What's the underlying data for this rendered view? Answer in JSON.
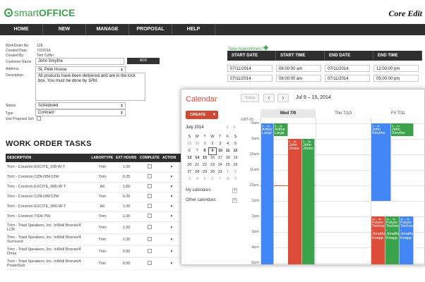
{
  "app": {
    "logo_smart": "smart",
    "logo_office": "OFFICE",
    "corner_title": "Core Edit"
  },
  "nav": [
    "HOME",
    "NEW",
    "MANAGE",
    "PROPOSAL",
    "HELP"
  ],
  "form": {
    "workorder_no_label": "WorkOrder No:",
    "workorder_no": "128",
    "created_date_label": "Created Date:",
    "created_date": "7/2/2014",
    "created_by_label": "Created By:",
    "created_by": "Tom Coffin",
    "customer_name_label": "Customer Name",
    "customer_name": "John Smythe",
    "add_label": "ADD",
    "address_label": "Address",
    "address": "St. Pete House",
    "description_label": "Description",
    "description": "All products have been delivered and are in the lock box. You must be done by 1PM.",
    "status_label": "Status",
    "status": "Scheduled",
    "type_label": "Type",
    "type": "Contract",
    "use_proposal_label": "Use Proposal Sch"
  },
  "tasks": {
    "title": "WORK ORDER TASKS",
    "headers": [
      "DESCRIPTION",
      "LABORTYPE",
      "EXT HOURS",
      "COMPLETE",
      "ACTION"
    ],
    "rows": [
      {
        "desc": "Trim - Crestron EXCITE_IO8-W-T",
        "labor": "Trim",
        "hours": "1.00"
      },
      {
        "desc": "Trim - Crestron C2N-DBF12W",
        "labor": "Trim",
        "hours": "0.25"
      },
      {
        "desc": "Trim - Crestron EXCITE_IW6-W-T",
        "labor": "All",
        "hours": "1.00"
      },
      {
        "desc": "Trim - Crestron C2N-DBF12W",
        "labor": "Trim",
        "hours": "0.25"
      },
      {
        "desc": "Trim - Crestron EXCITE_IW6-W-T",
        "labor": "All",
        "hours": "1.00"
      },
      {
        "desc": "Trim - Crestron TSW-750",
        "labor": "Trim",
        "hours": "1.00"
      },
      {
        "desc": "Trim - Triad Speakers, Inc. InWall Bronze/4 LCR",
        "labor": "Trim",
        "hours": "1.50"
      },
      {
        "desc": "Trim - Triad Speakers, Inc. InWall Bronze/4 Surround",
        "labor": "Trim",
        "hours": "1.00"
      },
      {
        "desc": "Trim - Triad Speakers, Inc. InWall Bronze/4 Omni",
        "labor": "Trim",
        "hours": "0.50"
      },
      {
        "desc": "Trim - Triad Speakers, Inc. InWall Bronze/4 PowerSub",
        "labor": "Trim",
        "hours": "0.50"
      }
    ],
    "action_glyph": "▾"
  },
  "appointments": {
    "new_label": "New Appointment",
    "plus": "✚",
    "headers": [
      "START DATE",
      "START TIME",
      "END DATE",
      "END TIME"
    ],
    "rows": [
      [
        "07/11/2014",
        "08:00:00 am",
        "07/11/2014",
        "12:00:00 pm"
      ],
      [
        "07/11/2014",
        "08:00:00 am",
        "07/11/2014",
        "05:00:00 pm"
      ]
    ]
  },
  "calendar": {
    "title": "Calendar",
    "today": "Today",
    "prev": "‹",
    "next": "›",
    "range": "Jul 9 – 15, 2014",
    "create": "CREATE",
    "create_caret": "▾",
    "tz": "GMT-05",
    "mini_month": "July 2014",
    "mini_nav": [
      "‹",
      "›"
    ],
    "mini_days": [
      "S",
      "M",
      "T",
      "W",
      "T",
      "F",
      "S"
    ],
    "mini_weeks": [
      [
        "29",
        "30",
        "1",
        "2",
        "3",
        "4",
        "5"
      ],
      [
        "6",
        "7",
        "8",
        "9",
        "10",
        "11",
        "12"
      ],
      [
        "13",
        "14",
        "15",
        "16",
        "17",
        "18",
        "19"
      ],
      [
        "20",
        "21",
        "22",
        "23",
        "24",
        "25",
        "26"
      ],
      [
        "27",
        "28",
        "29",
        "30",
        "31",
        "1",
        "2"
      ],
      [
        "3",
        "4",
        "5",
        "6",
        "7",
        "8",
        "9"
      ]
    ],
    "my_calendars": "My calendars",
    "other_calendars": "Other calendars",
    "side_arrow": "▾",
    "days": [
      "Wed 7/9",
      "Thu 7/10",
      "Fri 7/11"
    ],
    "times": [
      "8am",
      "9am",
      "10am",
      "11am",
      "12pm",
      "1pm",
      "2pm",
      "3pm",
      "4pm",
      "5pm"
    ],
    "events": [
      {
        "time": "8 – 4p",
        "title": "Arthur Large",
        "color": "#4285f4"
      },
      {
        "time": "8 – 4p",
        "title": "Arthur Large",
        "color": "#3aa24a"
      },
      {
        "time": "9 – 4p",
        "title": "John Jones",
        "color": "#dd4b39"
      },
      {
        "time": "9 – 4p",
        "title": "John Jones",
        "color": "#3aa24a"
      },
      {
        "time": "8 – 4p",
        "title": "John Smythe",
        "color": "#4285f4"
      },
      {
        "time": "8 – 4p",
        "title": "John Smythe",
        "color": "#3aa24a"
      },
      {
        "time": "3p – 5p",
        "title": "Future Technologies - Jonathan Knapp",
        "color": "#dd4b39"
      },
      {
        "time": "3p – 5p",
        "title": "Future Technologies - Jonathan Knapp",
        "color": "#3aa24a"
      },
      {
        "time": "3p – 5p",
        "title": "Future Technologies - Jonathan Knapp",
        "color": "#4285f4"
      }
    ]
  }
}
